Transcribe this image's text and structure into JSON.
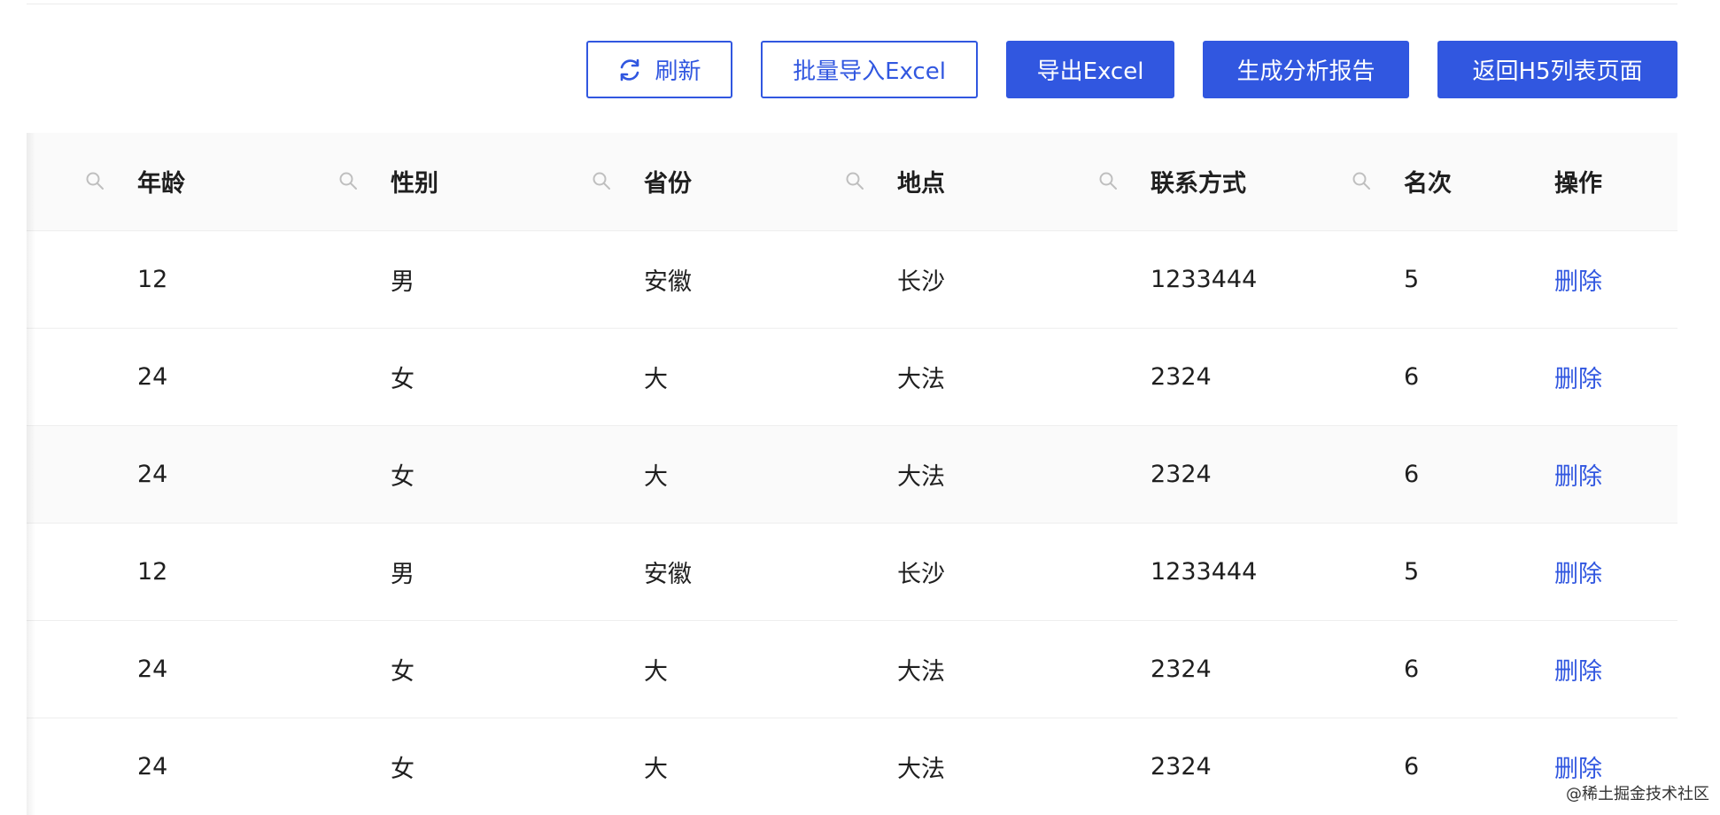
{
  "toolbar": {
    "refresh_label": "刷新",
    "import_label": "批量导入Excel",
    "export_label": "导出Excel",
    "report_label": "生成分析报告",
    "back_label": "返回H5列表页面"
  },
  "table": {
    "headers": {
      "age": "年龄",
      "gender": "性别",
      "province": "省份",
      "place": "地点",
      "contact": "联系方式",
      "rank": "名次",
      "ops": "操作"
    },
    "rows": [
      {
        "age": "12",
        "gender": "男",
        "province": "安徽",
        "place": "长沙",
        "contact": "1233444",
        "rank": "5",
        "action": "删除"
      },
      {
        "age": "24",
        "gender": "女",
        "province": "大",
        "place": "大法",
        "contact": "2324",
        "rank": "6",
        "action": "删除"
      },
      {
        "age": "24",
        "gender": "女",
        "province": "大",
        "place": "大法",
        "contact": "2324",
        "rank": "6",
        "action": "删除"
      },
      {
        "age": "12",
        "gender": "男",
        "province": "安徽",
        "place": "长沙",
        "contact": "1233444",
        "rank": "5",
        "action": "删除"
      },
      {
        "age": "24",
        "gender": "女",
        "province": "大",
        "place": "大法",
        "contact": "2324",
        "rank": "6",
        "action": "删除"
      },
      {
        "age": "24",
        "gender": "女",
        "province": "大",
        "place": "大法",
        "contact": "2324",
        "rank": "6",
        "action": "删除"
      }
    ]
  },
  "watermark": "@稀土掘金技术社区",
  "colors": {
    "primary": "#3157e0",
    "header_bg": "#fafafa",
    "border": "#eeeeee"
  },
  "icons": {
    "refresh": "refresh-icon",
    "column_filter": "search-icon"
  }
}
